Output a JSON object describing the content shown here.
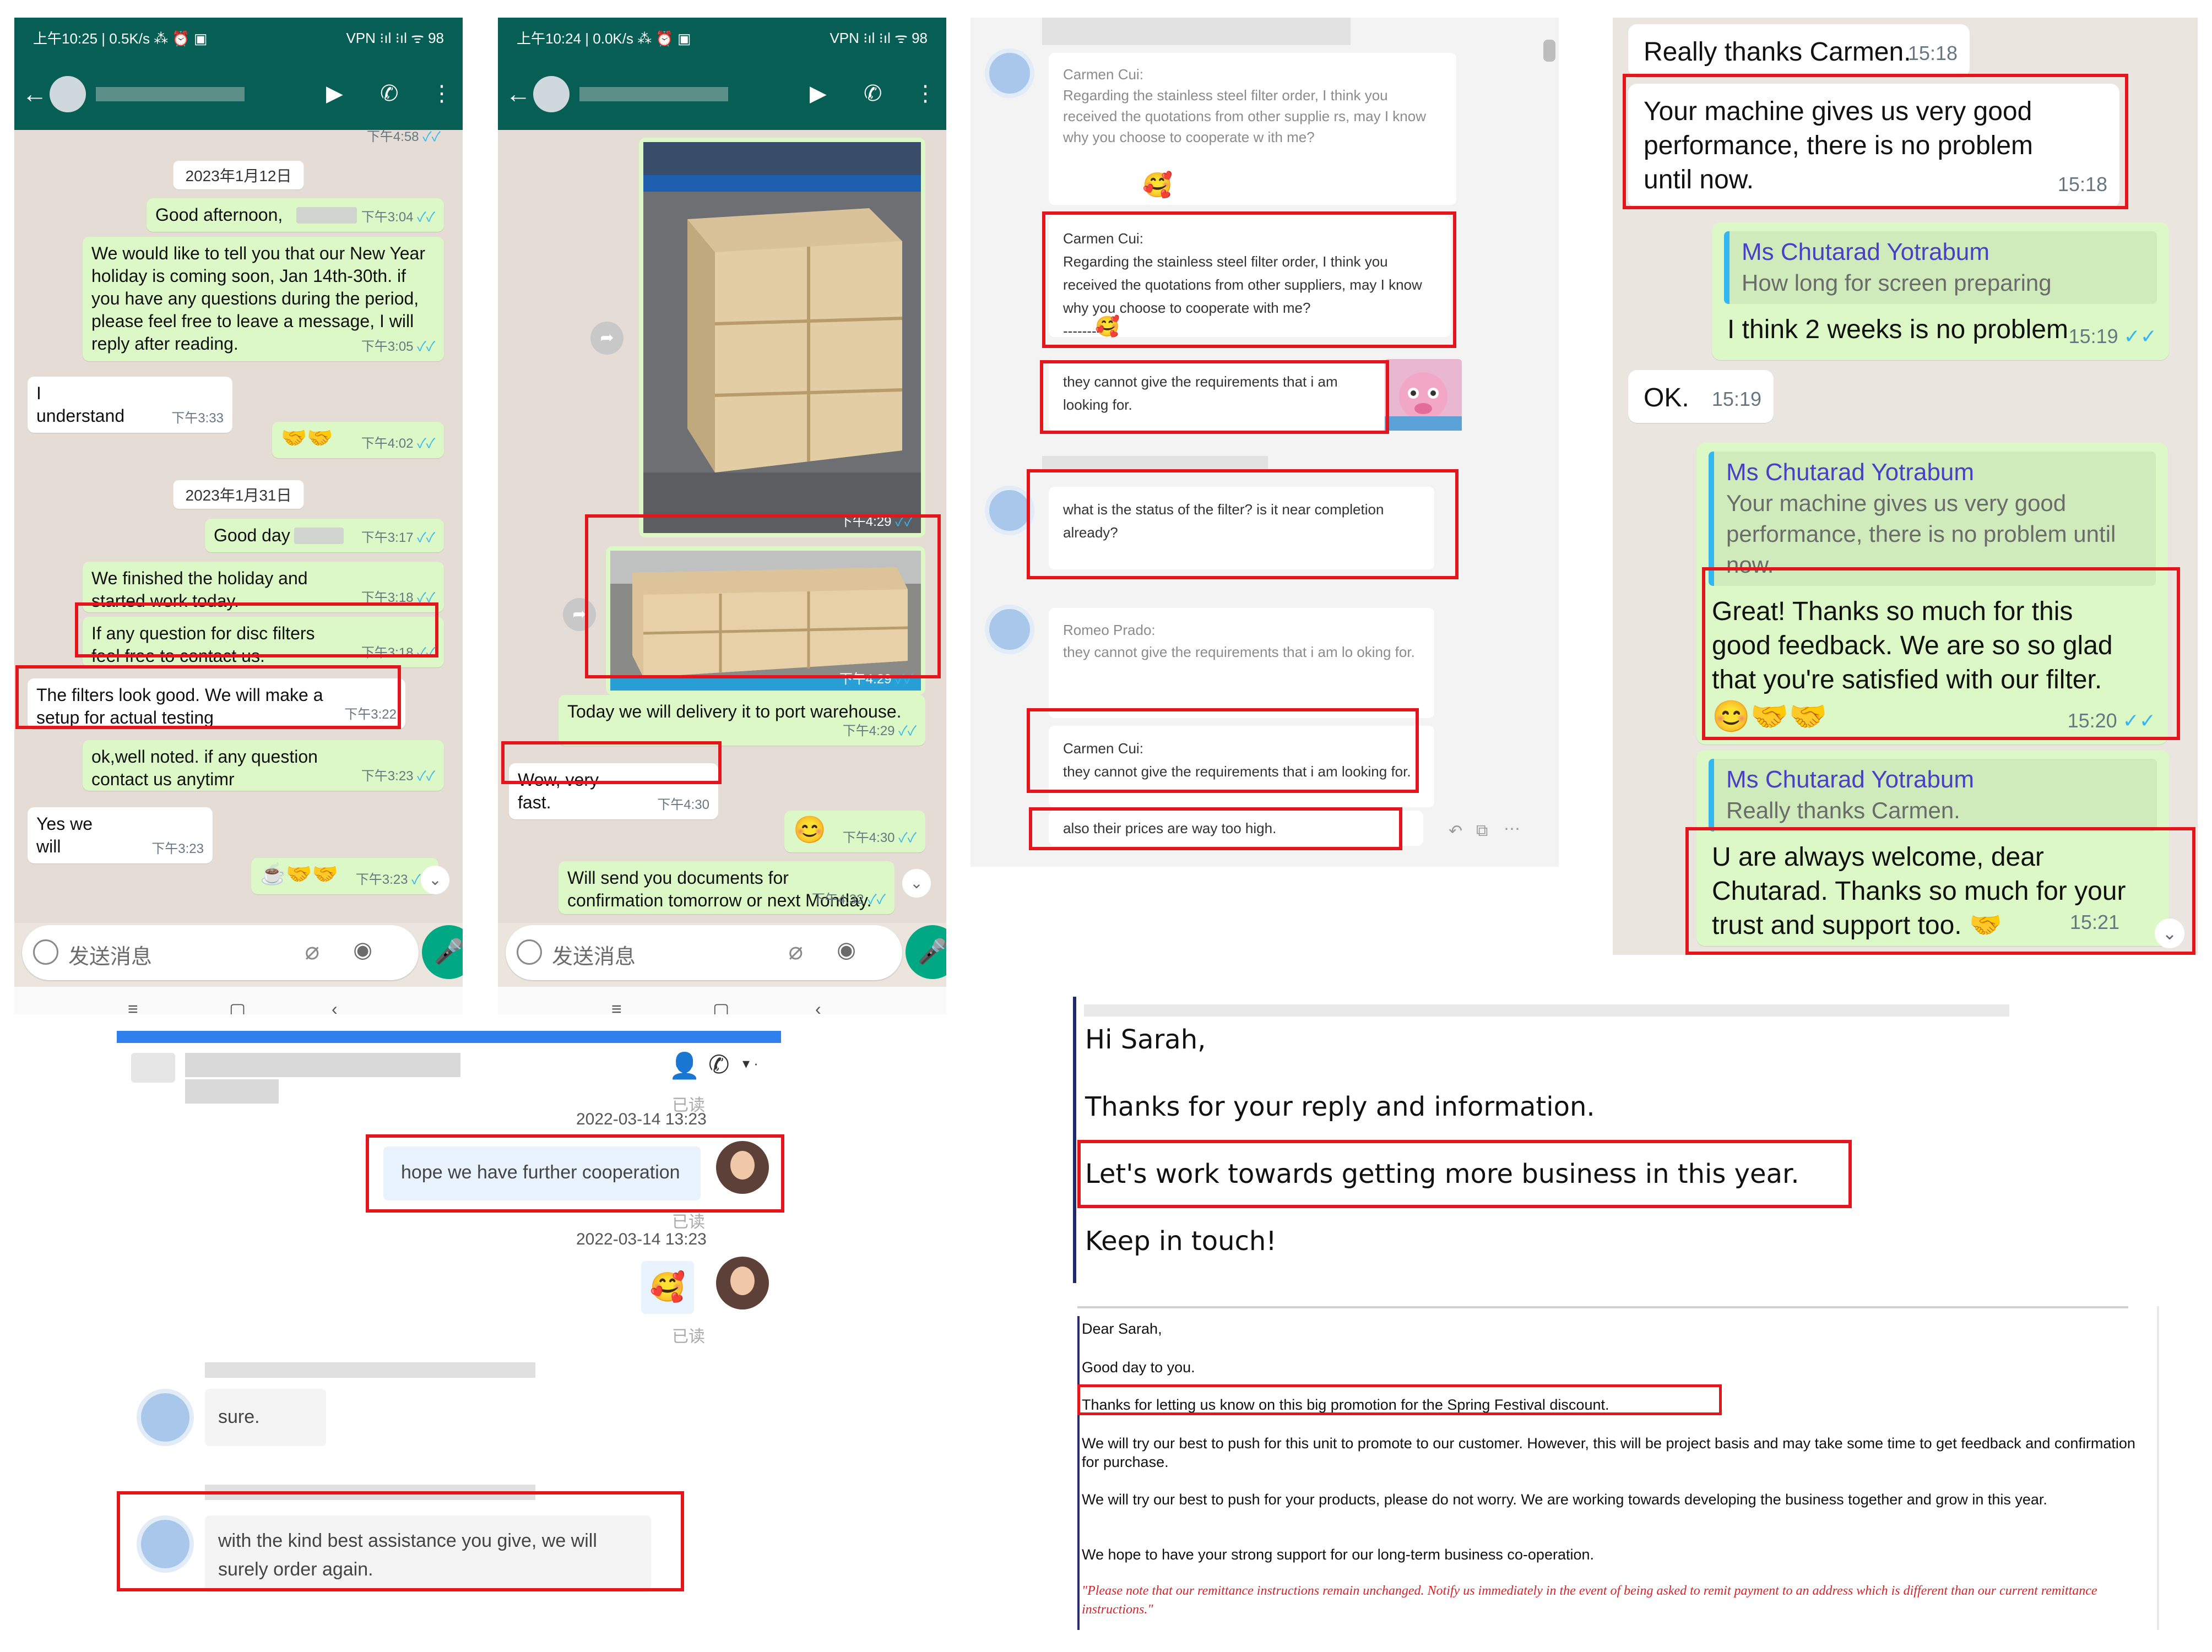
{
  "wa1": {
    "status_left": "上午10:25 | 0.5K/s ⁂ ⏰ ▣",
    "status_right": "VPN ⁝ıl ⁝ıl ᯤ 98",
    "input_placeholder": "发送消息",
    "top_time": "下午4:58",
    "date1": "2023年1月12日",
    "m1_text": "Good afternoon,",
    "m1_time": "下午3:04",
    "m2_text": "We would like to tell you that our New Year holiday is coming soon, Jan 14th-30th. if you have any questions during the period, please feel free to leave a message, I will reply after reading.",
    "m2_time": "下午3:05",
    "m3_text": "I understand",
    "m3_time": "下午3:33",
    "m4_emoji": "🤝🤝",
    "m4_time": "下午4:02",
    "date2": "2023年1月31日",
    "m5_text": "Good day",
    "m5_time": "下午3:17",
    "m6_text": "We finished the holiday and started work today.",
    "m6_time": "下午3:18",
    "m7_text": "If any question for disc filters feel free to contact us.",
    "m7_time": "下午3:18",
    "m8_text": "The filters look good. We will make a setup for actual testing",
    "m8_time": "下午3:22",
    "m9_text": "ok,well noted.  if any question contact us anytimr",
    "m9_time": "下午3:23",
    "m10_text": "Yes we will",
    "m10_time": "下午3:23",
    "m11_emoji": "☕🤝🤝",
    "m11_time": "下午3:23"
  },
  "wa2": {
    "status_left": "上午10:24 | 0.0K/s ⁂ ⏰ ▣",
    "status_right": "VPN ⁝ıl ⁝ıl ᯤ 98",
    "input_placeholder": "发送消息",
    "img1_time": "下午4:29",
    "img2_time": "下午4:29",
    "m1_text": "Today we will delivery it to port warehouse.",
    "m1_time": "下午4:29",
    "m2_text": "Wow, very fast.",
    "m2_time": "下午4:30",
    "m3_emoji": "😊",
    "m3_time": "下午4:30",
    "m4_text": "Will send you documents for confirmation tomorrow or next Monday.",
    "m4_time": "下午4:32"
  },
  "chat3": {
    "c1_name": "Carmen Cui:",
    "c1_text": "Regarding the stainless steel filter order, I think you received the quotations from other supplie rs, may I know why you choose to cooperate w ith me?",
    "c2_name": "Carmen Cui:",
    "c2_text": "Regarding the stainless steel filter order, I think you received the quotations from other suppliers, may I know why you choose to cooperate with me?",
    "c2_sep": "---------",
    "c3_text": "they cannot give the requirements that i am looking for.",
    "c4_text": "what is the status of the filter? is it near completion already?",
    "c5_name": "Romeo Prado:",
    "c5_text": "they cannot give the requirements that i am lo oking for.",
    "c6_name": "Carmen Cui:",
    "c6_text": "they cannot give the requirements that i am looking for.",
    "c6_sep": "---------",
    "c7_text": "also their prices are way too high."
  },
  "wa4": {
    "m1_text": "Really thanks Carmen.",
    "m1_time": "15:18",
    "m2_text": "Your machine gives us very good performance, there is no problem until now.",
    "m2_time": "15:18",
    "m3_quote_name": "Ms Chutarad Yotrabum",
    "m3_quote_text": "How long for screen preparing",
    "m3_text": "I think 2 weeks is no problem",
    "m3_time": "15:19",
    "m4_text": "OK.",
    "m4_time": "15:19",
    "m5_quote_name": "Ms Chutarad Yotrabum",
    "m5_quote_text": "Your machine gives us very good performance, there is no problem until now.",
    "m5_text": "Great!  Thanks so much for this good feedback.  We are so so glad that you're satisfied with our filter.",
    "m5_emoji": "😊🤝🤝",
    "m5_time": "15:20",
    "m6_quote_name": "Ms Chutarad Yotrabum",
    "m6_quote_text": "Really thanks Carmen.",
    "m6_text": "U are always welcome, dear Chutarad. Thanks so much for your trust and support too.",
    "m6_emoji": "🤝",
    "m6_time": "15:21"
  },
  "chat5": {
    "read_label": "已读",
    "ts1": "2022-03-14 13:23",
    "m1_text": "hope we have further cooperation",
    "ts2": "2022-03-14 13:23",
    "m2_emoji": "🥰",
    "m3_text": "sure.",
    "m4_text": "with the kind best assistance you give, we will surely order again."
  },
  "mail1": {
    "l1": "Hi Sarah,",
    "l2": "Thanks for your reply and information.",
    "l3": "Let's work towards getting more business in this year.",
    "l4": "Keep in touch!"
  },
  "mail2": {
    "l1": "Dear Sarah,",
    "l2": "Good day to you.",
    "l3": "Thanks for letting us know on this big promotion for the Spring Festival discount.",
    "p1": "We will try our best to push for this unit to promote to our customer. However, this will be project basis and may take some time to get feedback and confirmation for purchase.",
    "p2": "We will try our best to push for your products, please do not worry. We are working towards developing the business together and grow in this year.",
    "p3": "We hope to have your strong support for our long-term business co-operation.",
    "note": "\"Please note that our remittance instructions remain unchanged. Notify us immediately in the event of being asked to remit payment to an address which is different than our current remittance instructions.\""
  },
  "colors": {
    "highlight_red": "#e3161e",
    "wa_green": "#075e54",
    "bubble_out": "#dcf8c6",
    "read_tick": "#34b7f1",
    "quote_name": "#4a3fc7"
  }
}
